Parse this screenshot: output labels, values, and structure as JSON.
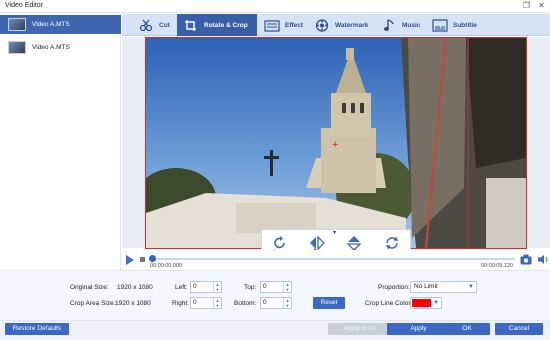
{
  "window": {
    "title": "Video Editor",
    "restore_glyph": "❐",
    "close_glyph": "✕"
  },
  "sidebar": {
    "items": [
      {
        "name": "Video A.MTS",
        "selected": true
      },
      {
        "name": "Video A.MTS",
        "selected": false
      }
    ]
  },
  "tabs": [
    {
      "label": "Cut",
      "icon": "scissors-icon"
    },
    {
      "label": "Rotate & Crop",
      "icon": "rotate-crop-icon",
      "active": true
    },
    {
      "label": "Effect",
      "icon": "effect-icon"
    },
    {
      "label": "Watermark",
      "icon": "watermark-icon"
    },
    {
      "label": "Music",
      "icon": "music-icon"
    },
    {
      "label": "Subtitle",
      "icon": "subtitle-icon"
    }
  ],
  "preview": {
    "crop_center_glyph": "+",
    "toolbar": [
      "rotate-right-icon",
      "flip-horizontal-icon",
      "flip-vertical-icon",
      "rotate-reset-icon"
    ]
  },
  "timeline": {
    "current_time": "00:00:00.000",
    "total_time": "00:00:09.120",
    "progress": 0.0
  },
  "settings": {
    "original_size_label": "Original Size:",
    "original_size_value": "1920 x 1080",
    "crop_area_size_label": "Crop Area Size:",
    "crop_area_size_value": "1920 x 1080",
    "left_label": "Left:",
    "left_value": "0",
    "right_label": "Right:",
    "right_value": "0",
    "top_label": "Top:",
    "top_value": "0",
    "bottom_label": "Bottom:",
    "bottom_value": "0",
    "reset_label": "Reset",
    "proportion_label": "Proportion:",
    "proportion_value": "No Limit",
    "crop_line_color_label": "Crop Line Color:",
    "crop_line_color": "#ff0000"
  },
  "footer": {
    "restore_defaults": "Restore Defaults",
    "apply_to_all": "Apply to All",
    "apply": "Apply",
    "ok": "OK",
    "cancel": "Cancel"
  },
  "colors": {
    "accent": "#3a68c4",
    "crop_border": "#e1262b",
    "annotation_arrow": "#c0392b"
  }
}
